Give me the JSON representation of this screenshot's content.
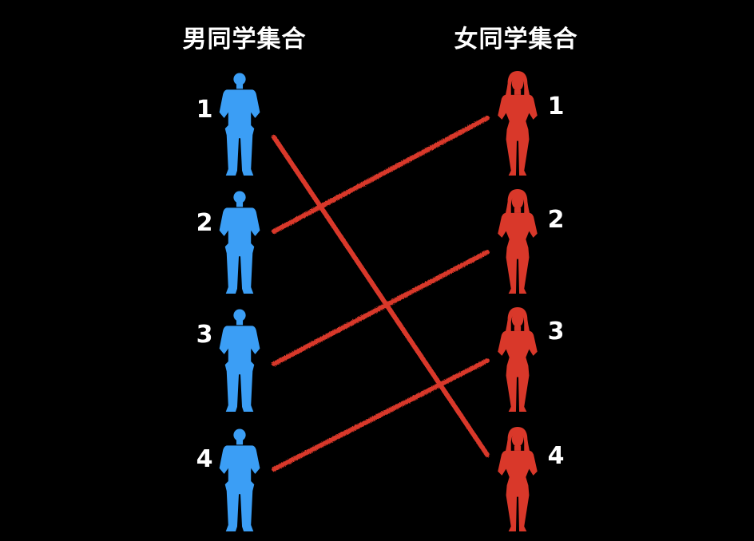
{
  "left_title": "男同学集合",
  "right_title": "女同学集合",
  "colors": {
    "background": "#000000",
    "boy": "#3b9ef5",
    "girl": "#d9382a",
    "line": "#d9382a",
    "text": "#ffffff"
  },
  "boys": [
    {
      "label": "1"
    },
    {
      "label": "2"
    },
    {
      "label": "3"
    },
    {
      "label": "4"
    }
  ],
  "girls": [
    {
      "label": "1"
    },
    {
      "label": "2"
    },
    {
      "label": "3"
    },
    {
      "label": "4"
    }
  ],
  "mapping": [
    {
      "boy": "1",
      "girl": "4"
    },
    {
      "boy": "2",
      "girl": "1"
    },
    {
      "boy": "3",
      "girl": "2"
    },
    {
      "boy": "4",
      "girl": "3"
    }
  ]
}
